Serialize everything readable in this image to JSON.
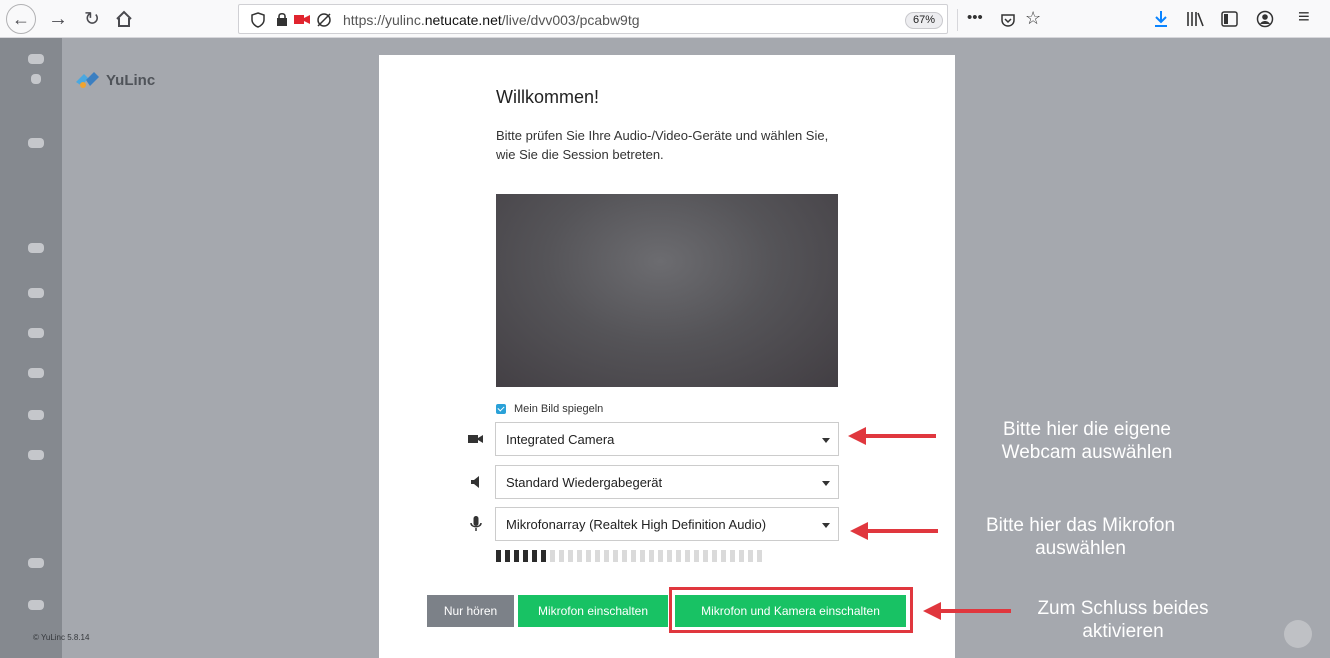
{
  "browser": {
    "url_prefix": "https://yulinc.",
    "url_domain": "netucate.net",
    "url_path": "/live/dvv003/pcabw9tg",
    "zoom_level": "67%"
  },
  "app": {
    "brand_name": "YuLinc",
    "version": "© YuLinc 5.8.14"
  },
  "dialog": {
    "title": "Willkommen!",
    "description": "Bitte prüfen Sie Ihre Audio-/Video-Geräte und wählen Sie, wie Sie die Session betreten.",
    "mirror_label": "Mein Bild spiegeln",
    "mirror_checked": true,
    "camera_value": "Integrated Camera",
    "speaker_value": "Standard Wiedergabegerät",
    "mic_value": "Mikrofonarray (Realtek High Definition Audio)",
    "mic_level": 0.2,
    "buttons": {
      "listen_only": "Nur hören",
      "mic_on": "Mikrofon einschalten",
      "mic_and_camera_on": "Mikrofon und Kamera einschalten"
    }
  },
  "annotations": {
    "webcam_line1": "Bitte hier die eigene",
    "webcam_line2": "Webcam auswählen",
    "mic_line1": "Bitte hier das Mikrofon",
    "mic_line2": "auswählen",
    "final_line1": "Zum Schluss beides",
    "final_line2": "aktivieren"
  },
  "colors": {
    "accent_green": "#18c264",
    "annotation_red": "#e0373e",
    "checkbox_blue": "#2aa1d8"
  }
}
